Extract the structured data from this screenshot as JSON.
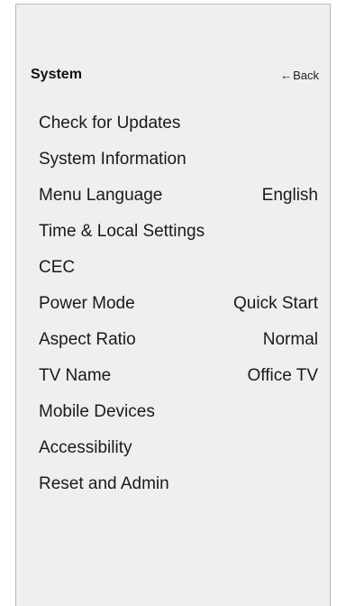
{
  "header": {
    "title": "System",
    "back_arrow": "←",
    "back_label": "Back"
  },
  "menu": {
    "items": [
      {
        "label": "Check for Updates",
        "value": ""
      },
      {
        "label": "System Information",
        "value": ""
      },
      {
        "label": "Menu Language",
        "value": "English"
      },
      {
        "label": "Time & Local Settings",
        "value": ""
      },
      {
        "label": "CEC",
        "value": ""
      },
      {
        "label": "Power Mode",
        "value": "Quick Start"
      },
      {
        "label": "Aspect Ratio",
        "value": "Normal"
      },
      {
        "label": "TV Name",
        "value": "Office TV"
      },
      {
        "label": "Mobile Devices",
        "value": ""
      },
      {
        "label": "Accessibility",
        "value": ""
      },
      {
        "label": "Reset and Admin",
        "value": ""
      }
    ]
  }
}
